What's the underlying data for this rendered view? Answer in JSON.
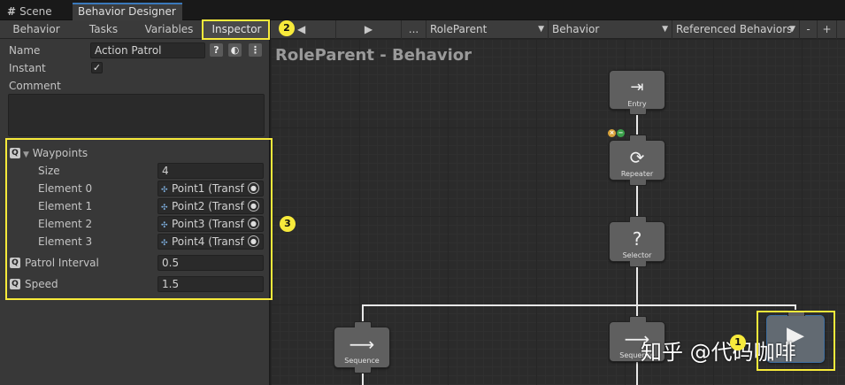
{
  "window_tabs": [
    {
      "label": "Scene",
      "icon": "grid-hash-icon"
    },
    {
      "label": "Behavior Designer"
    }
  ],
  "left_tabs": [
    "Behavior",
    "Tasks",
    "Variables",
    "Inspector"
  ],
  "inspector": {
    "name_label": "Name",
    "name_value": "Action Patrol",
    "instant_label": "Instant",
    "instant_checked": true,
    "comment_label": "Comment",
    "waypoints": {
      "label": "Waypoints",
      "size_label": "Size",
      "size_value": "4",
      "elements": [
        {
          "label": "Element 0",
          "value": "Point1 (Transf"
        },
        {
          "label": "Element 1",
          "value": "Point2 (Transf"
        },
        {
          "label": "Element 2",
          "value": "Point3 (Transf"
        },
        {
          "label": "Element 3",
          "value": "Point4 (Transf"
        }
      ]
    },
    "patrol_interval_label": "Patrol Interval",
    "patrol_interval_value": "0.5",
    "speed_label": "Speed",
    "speed_value": "1.5"
  },
  "toolbar": {
    "back": "◀",
    "play": "▶",
    "more": "...",
    "object": "RoleParent",
    "behavior": "Behavior",
    "referenced": "Referenced Behaviors",
    "minus": "-",
    "plus": "+"
  },
  "graph": {
    "title": "RoleParent - Behavior",
    "nodes": [
      {
        "label": "Entry",
        "icon": "entry-icon"
      },
      {
        "label": "Repeater",
        "icon": "repeat-icon"
      },
      {
        "label": "Selector",
        "icon": "question-icon"
      },
      {
        "label": "Sequence",
        "icon": "arrow-right-icon"
      },
      {
        "label": "Sequence",
        "icon": "arrow-right-icon"
      },
      {
        "label": "",
        "icon": "play-icon"
      }
    ]
  },
  "annotations": [
    "1",
    "2",
    "3"
  ],
  "watermark": "知乎 @代码咖啡",
  "colors": {
    "highlight": "#f7ea3b",
    "active_tab_accent": "#3a79bb"
  }
}
